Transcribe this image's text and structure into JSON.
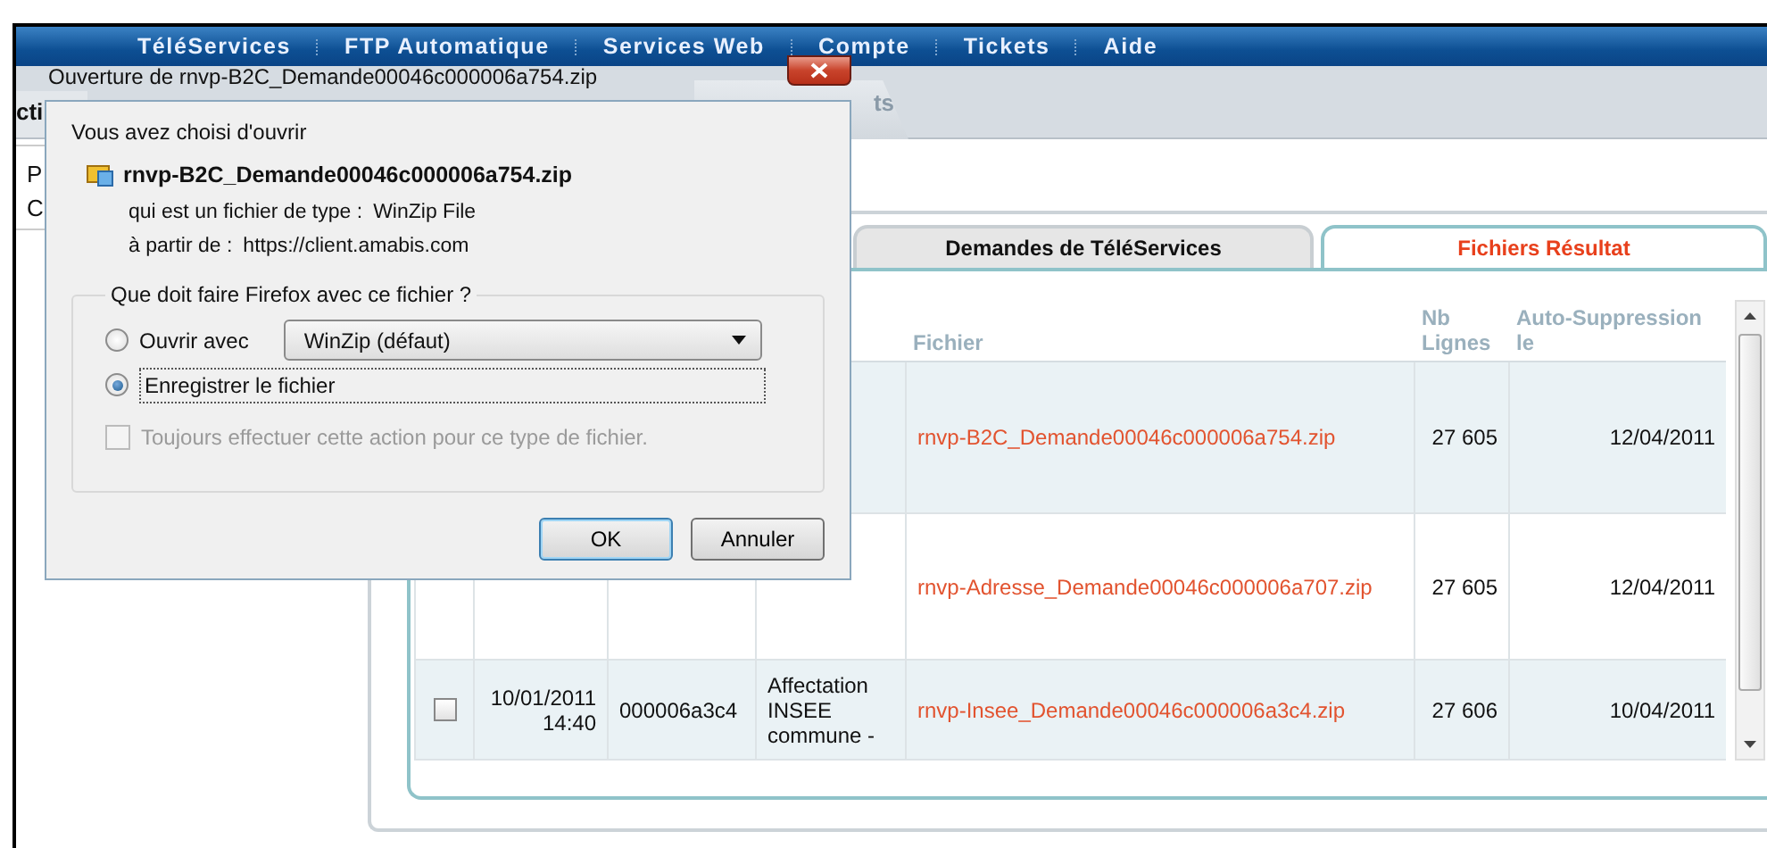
{
  "nav": {
    "items": [
      "TéléServices",
      "FTP Automatique",
      "Services Web",
      "Compte",
      "Tickets",
      "Aide"
    ]
  },
  "left_panel": {
    "tab_label": "cti",
    "lines": [
      "P",
      "C"
    ]
  },
  "section_tab": {
    "label": "ts"
  },
  "tabs": [
    {
      "label": "Demandes de TéléServices",
      "selected": false
    },
    {
      "label": "Fichiers Résultat",
      "selected": true
    }
  ],
  "table": {
    "columns": [
      "Fichier",
      "Nb Lignes",
      "Auto-Suppression le"
    ],
    "rows": [
      {
        "file": "rnvp-B2C_Demande00046c000006a754.zip",
        "lines": "27 605",
        "deletion": "12/04/2011"
      },
      {
        "file": "rnvp-Adresse_Demande00046c000006a707.zip",
        "lines": "27 605",
        "deletion": "12/04/2011"
      },
      {
        "checked": false,
        "date": "10/01/2011 14:40",
        "id": "000006a3c4",
        "type": "Affectation INSEE commune -",
        "file": "rnvp-Insee_Demande00046c000006a3c4.zip",
        "lines": "27 606",
        "deletion": "10/04/2011"
      }
    ]
  },
  "dialog": {
    "title": "Ouverture de rnvp-B2C_Demande00046c000006a754.zip",
    "heading": "Vous avez choisi d'ouvrir",
    "filename": "rnvp-B2C_Demande00046c000006a754.zip",
    "type_label": "qui est un fichier de type :",
    "type_value": "WinZip File",
    "from_label": "à partir de :",
    "from_value": "https://client.amabis.com",
    "group_title": "Que doit faire Firefox avec ce fichier ?",
    "options": [
      {
        "kind": "open_with",
        "label": "Ouvrir avec",
        "selected": false,
        "app": "WinZip (défaut)"
      },
      {
        "kind": "save",
        "label": "Enregistrer le fichier",
        "selected": true
      }
    ],
    "remember": {
      "label": "Toujours effectuer cette action pour ce type de fichier.",
      "checked": false,
      "disabled": true
    },
    "buttons": [
      {
        "label": "OK",
        "default": true
      },
      {
        "label": "Annuler",
        "default": false
      }
    ]
  }
}
